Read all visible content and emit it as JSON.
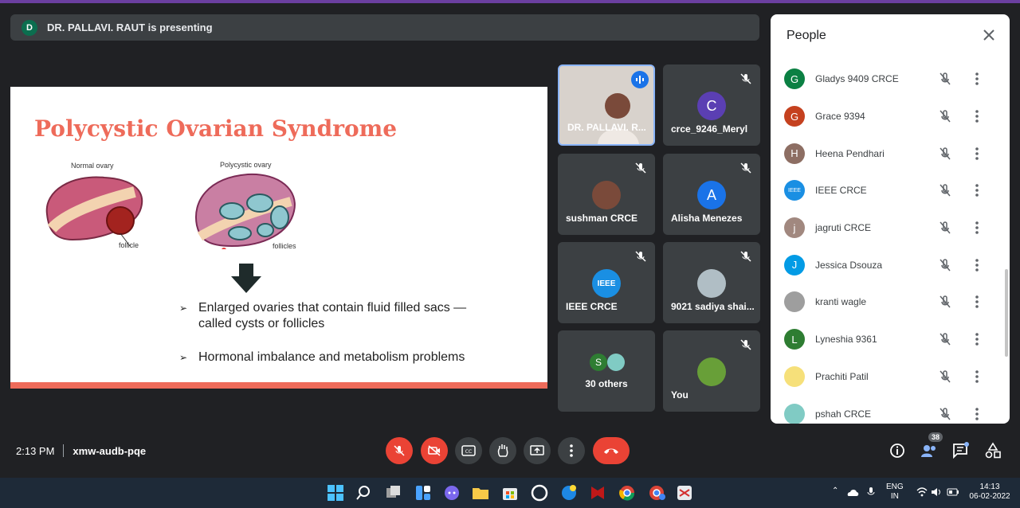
{
  "banner": {
    "avatar_letter": "D",
    "text": "DR. PALLAVI. RAUT is presenting"
  },
  "slide": {
    "title": "Polycystic Ovarian Syndrome",
    "captions": {
      "normal": "Normal ovary",
      "polycystic": "Polycystic ovary",
      "follicle": "follicle",
      "follicles": "follicles"
    },
    "bullets": [
      {
        "marker": "➢",
        "lines": [
          "Enlarged ovaries that contain fluid filled sacs —",
          "called cysts or follicles"
        ]
      },
      {
        "marker": "➢",
        "lines": [
          "Hormonal imbalance and metabolism problems"
        ]
      }
    ],
    "colors": {
      "accent": "#ee6b5a"
    }
  },
  "tiles": [
    {
      "name": "DR. PALLAVI. R...",
      "speaking": true
    },
    {
      "name": "crce_9246_Meryl",
      "letter": "C",
      "color": "#5b3fb3"
    },
    {
      "name": "sushman CRCE"
    },
    {
      "name": "Alisha Menezes",
      "letter": "A",
      "color": "#1a73e8"
    },
    {
      "name": "IEEE CRCE",
      "logo_text": "IEEE"
    },
    {
      "name": "9021 sadiya shai..."
    },
    {
      "name": "30 others",
      "letter": "S"
    },
    {
      "name": "You"
    }
  ],
  "people_panel": {
    "title": "People",
    "participants": [
      {
        "letter": "G",
        "name": "Gladys 9409 CRCE",
        "color": "#0b8043"
      },
      {
        "letter": "G",
        "name": "Grace 9394",
        "color": "#c5411f"
      },
      {
        "letter": "H",
        "name": "Heena Pendhari",
        "color": "#8d6e63"
      },
      {
        "letter": "IEEE",
        "name": "IEEE CRCE",
        "color": "#1a8fe3"
      },
      {
        "letter": "j",
        "name": "jagruti CRCE",
        "color": "#a1887f"
      },
      {
        "letter": "J",
        "name": "Jessica Dsouza",
        "color": "#039be5"
      },
      {
        "letter": "",
        "name": "kranti wagle",
        "color": "#9e9e9e"
      },
      {
        "letter": "L",
        "name": "Lyneshia 9361",
        "color": "#2e7d32"
      },
      {
        "letter": "",
        "name": "Prachiti Patil",
        "color": "#f6e07a"
      },
      {
        "letter": "",
        "name": "pshah CRCE",
        "color": "#80cbc4"
      }
    ]
  },
  "meeting": {
    "time": "2:13 PM",
    "code": "xmw-audb-pqe",
    "people_count": "38"
  },
  "taskbar": {
    "lang1": "ENG",
    "lang2": "IN",
    "clock": "14:13",
    "date": "06-02-2022"
  }
}
